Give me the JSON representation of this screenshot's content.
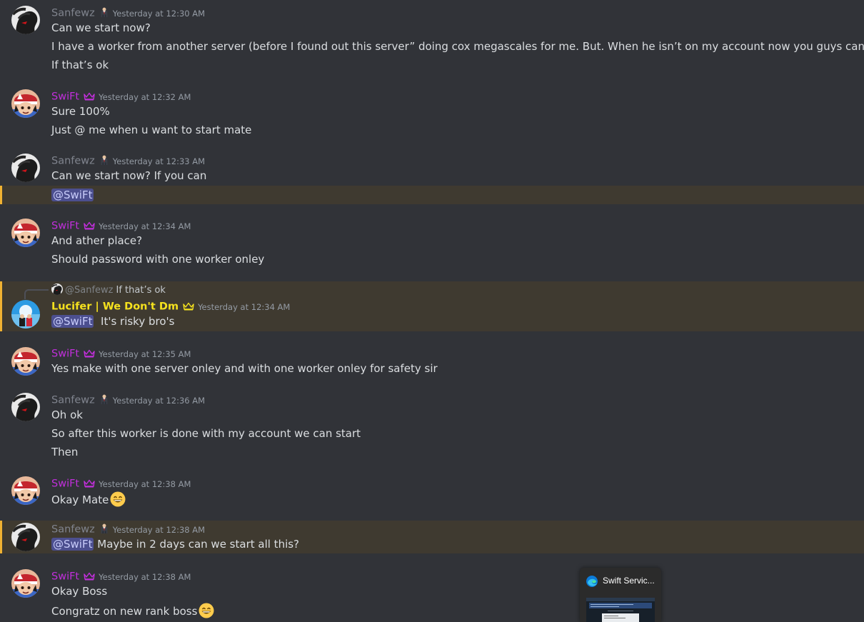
{
  "users": {
    "sanfewz": "Sanfewz",
    "swift": "SwiFt",
    "lucifer": "Lucifer | We Don't Dm"
  },
  "icons": {
    "sanfewz_badge": "man-in-suit-icon",
    "swift_badge": "crown-icon",
    "lucifer_badge": "crown-icon",
    "grin_emoji": "grinning-face-icon",
    "edge": "edge-browser-icon"
  },
  "colors": {
    "background": "#313338",
    "highlight_bg": "#3f3a30",
    "highlight_bar": "#f0b232",
    "swift_name": "#c22fdc",
    "lucifer_name": "#f5e11e",
    "sanfewz_name": "#80848e",
    "mention_bg": "#4c4f8f"
  },
  "messages": [
    {
      "author": "Sanfewz",
      "timestamp": "Yesterday at 12:30 AM",
      "lines": [
        "Can we start now?",
        "I have a worker from another server (before I found out this server” doing cox megascales for me. But. When he isn’t on my account now you guys can",
        "If that’s ok"
      ]
    },
    {
      "author": "SwiFt",
      "timestamp": "Yesterday at 12:32 AM",
      "lines": [
        "Sure 100%",
        "Just @ me when u want to start mate"
      ]
    },
    {
      "author": "Sanfewz",
      "timestamp": "Yesterday at 12:33 AM",
      "lines": [
        "Can we start now? If you can"
      ],
      "mention": "@SwiFt"
    },
    {
      "author": "SwiFt",
      "timestamp": "Yesterday at 12:34 AM",
      "lines": [
        "And ather place?",
        "Should password with one worker onley"
      ]
    },
    {
      "author": "Lucifer | We Don't Dm",
      "timestamp": "Yesterday at 12:34 AM",
      "reply_to": {
        "name": "@Sanfewz",
        "text": "If that’s ok"
      },
      "mention": "@SwiFt",
      "lines": [
        "It's risky bro's"
      ]
    },
    {
      "author": "SwiFt",
      "timestamp": "Yesterday at 12:35 AM",
      "lines": [
        "Yes make with one server onley and with one worker onley for safety sir"
      ]
    },
    {
      "author": "Sanfewz",
      "timestamp": "Yesterday at 12:36 AM",
      "lines": [
        "Oh ok",
        "So after this worker is done with my account we can start",
        "Then"
      ]
    },
    {
      "author": "SwiFt",
      "timestamp": "Yesterday at 12:38 AM",
      "lines": [
        "Okay Mate"
      ]
    },
    {
      "author": "Sanfewz",
      "timestamp": "Yesterday at 12:38 AM",
      "mention": "@SwiFt",
      "lines": [
        "Maybe in 2 days can we start all this?"
      ]
    },
    {
      "author": "SwiFt",
      "timestamp": "Yesterday at 12:38 AM",
      "lines": [
        "Okay Boss",
        "Congratz on new rank boss"
      ]
    }
  ],
  "taskbar_preview": {
    "title": "Swift Servic..."
  }
}
